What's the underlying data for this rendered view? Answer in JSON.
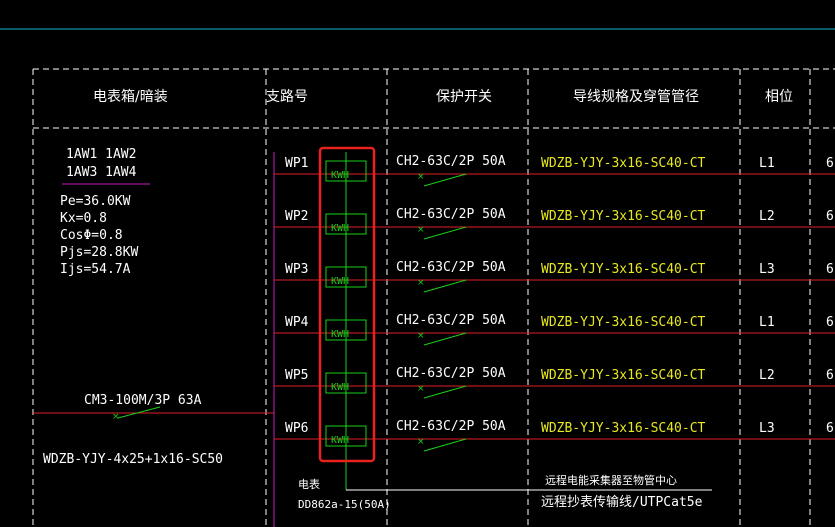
{
  "header": {
    "col1": "电表箱/暗装",
    "col2": "支路号",
    "col3": "保护开关",
    "col4": "导线规格及穿管管径",
    "col5": "相位"
  },
  "box": {
    "ids_line1": "1AW1  1AW2",
    "ids_line2": "1AW3  1AW4",
    "pe": "Pe=36.0KW",
    "kx": "Kx=0.8",
    "cos": "CosΦ=0.8",
    "pjs": "Pjs=28.8KW",
    "ijs": "Ijs=54.7A",
    "main_breaker": "CM3-100M/3P 63A",
    "main_cable": "WDZB-YJY-4x25+1x16-SC50"
  },
  "meter_label": "KWH",
  "circuits": [
    {
      "id": "WP1",
      "breaker": "CH2-63C/2P 50A",
      "cable": "WDZB-YJY-3x16-SC40-CT",
      "phase": "L1",
      "extra": "6"
    },
    {
      "id": "WP2",
      "breaker": "CH2-63C/2P 50A",
      "cable": "WDZB-YJY-3x16-SC40-CT",
      "phase": "L2",
      "extra": "6"
    },
    {
      "id": "WP3",
      "breaker": "CH2-63C/2P 50A",
      "cable": "WDZB-YJY-3x16-SC40-CT",
      "phase": "L3",
      "extra": "6"
    },
    {
      "id": "WP4",
      "breaker": "CH2-63C/2P 50A",
      "cable": "WDZB-YJY-3x16-SC40-CT",
      "phase": "L1",
      "extra": "6"
    },
    {
      "id": "WP5",
      "breaker": "CH2-63C/2P 50A",
      "cable": "WDZB-YJY-3x16-SC40-CT",
      "phase": "L2",
      "extra": "6"
    },
    {
      "id": "WP6",
      "breaker": "CH2-63C/2P 50A",
      "cable": "WDZB-YJY-3x16-SC40-CT",
      "phase": "L3",
      "extra": "6"
    }
  ],
  "footer": {
    "meter_type_label": "电表",
    "meter_model": "DD862a-15(50A)",
    "note1": "远程电能采集器至物管中心",
    "note2": "远程抄表传输线/UTPCat5e"
  },
  "colors": {
    "cyan": "#0fb5c8",
    "red": "#e0202a",
    "green": "#19d119",
    "yellow": "#e8e820",
    "magenta": "#c020c0",
    "highlight": "#e8231d"
  }
}
